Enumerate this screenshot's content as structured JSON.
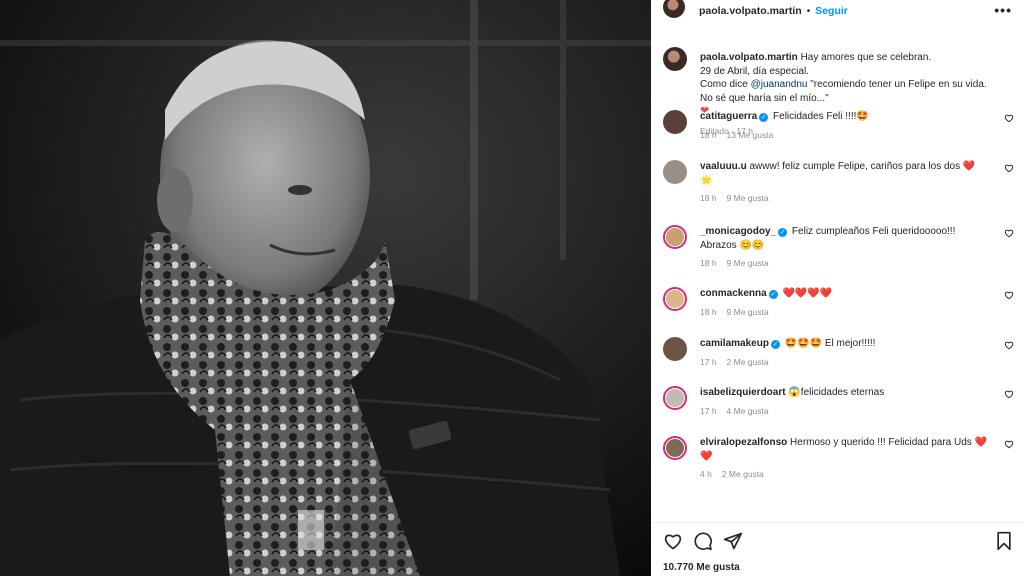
{
  "post": {
    "username": "paola.volpato.martin",
    "follow_label": "Seguir",
    "more_icon": "more-horizontal-icon",
    "caption_lines": [
      "Hay amores que se celebran.",
      "29 de Abril, día especial.",
      "Como dice",
      "@juanandnu",
      "\"recomiendo tener un Felipe en su vida.",
      "No sé que haría sin el mío...\"",
      "❤"
    ],
    "caption_meta": "Editado · 17 h",
    "likes": "10.770 Me gusta"
  },
  "comments": [
    {
      "user": "catitaguerra",
      "verified": true,
      "text": "Felicidades Feli !!!!🤩",
      "time": "18 h",
      "likes": "13 Me gusta",
      "story": false,
      "avatar_color": "#5a4038"
    },
    {
      "user": "vaaluuu.u",
      "verified": false,
      "text": "awww! feliz cumple Felipe, cariños para los dos ❤️ 🌟",
      "time": "18 h",
      "likes": "9 Me gusta",
      "story": false,
      "avatar_color": "#9a8f84"
    },
    {
      "user": "_monicagodoy_",
      "verified": true,
      "text": "Feliz cumpleaños Feli queridooooo!!! Abrazos 😊😊",
      "time": "18 h",
      "likes": "9 Me gusta",
      "story": true,
      "avatar_color": "#c9a070"
    },
    {
      "user": "conmackenna",
      "verified": true,
      "text": "❤️❤️❤️❤️",
      "time": "18 h",
      "likes": "9 Me gusta",
      "story": true,
      "avatar_color": "#d8b88a"
    },
    {
      "user": "camilamakeup",
      "verified": true,
      "text": "🤩🤩🤩 El mejor!!!!!",
      "time": "17 h",
      "likes": "2 Me gusta",
      "story": false,
      "avatar_color": "#6b5346"
    },
    {
      "user": "isabelizquierdoart",
      "verified": false,
      "text": "😱felicidades eternas",
      "time": "17 h",
      "likes": "4 Me gusta",
      "story": true,
      "avatar_color": "#c0bcb5"
    },
    {
      "user": "elviralopezalfonso",
      "verified": false,
      "text": "Hermoso y querido !!! Felicidad para Uds ❤️❤️",
      "time": "4 h",
      "likes": "2 Me gusta",
      "story": true,
      "avatar_color": "#7e6a55"
    }
  ],
  "icons": {
    "like": "heart-outline-icon",
    "comment": "comment-bubble-icon",
    "share": "paper-plane-icon",
    "save": "bookmark-icon"
  },
  "colors": {
    "accent": "#0095f6",
    "story_ring": "#d62976",
    "heart": "#ed4956",
    "muted_text": "#8e8e8e"
  }
}
